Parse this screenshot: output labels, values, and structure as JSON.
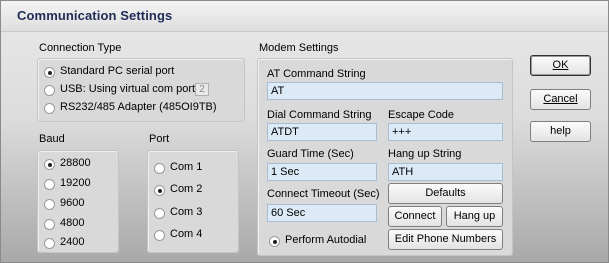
{
  "window": {
    "title": "Communication Settings"
  },
  "connection_type": {
    "label": "Connection Type",
    "options": [
      {
        "label": "Standard PC serial port",
        "selected": true
      },
      {
        "label": "USB: Using virtual com port #",
        "selected": false
      },
      {
        "label": "RS232/485 Adapter (485OI9TB)",
        "selected": false
      }
    ],
    "usb_port_value": "2"
  },
  "baud": {
    "label": "Baud",
    "options": [
      {
        "label": "28800",
        "selected": true
      },
      {
        "label": "19200",
        "selected": false
      },
      {
        "label": "9600",
        "selected": false
      },
      {
        "label": "4800",
        "selected": false
      },
      {
        "label": "2400",
        "selected": false
      }
    ]
  },
  "port": {
    "label": "Port",
    "options": [
      {
        "label": "Com 1",
        "selected": false
      },
      {
        "label": "Com 2",
        "selected": true
      },
      {
        "label": "Com 3",
        "selected": false
      },
      {
        "label": "Com 4",
        "selected": false
      }
    ]
  },
  "modem": {
    "label": "Modem Settings",
    "at_command_label": "AT Command String",
    "at_command_value": "AT",
    "dial_command_label": "Dial Command String",
    "dial_command_value": "ATDT",
    "escape_code_label": "Escape Code",
    "escape_code_value": "+++",
    "guard_time_label": "Guard Time (Sec)",
    "guard_time_value": "1 Sec",
    "hangup_string_label": "Hang up String",
    "hangup_string_value": "ATH",
    "connect_timeout_label": "Connect Timeout (Sec)",
    "connect_timeout_value": "60 Sec",
    "autodial_label": "Perform Autodial",
    "autodial_selected": true,
    "defaults_label": "Defaults",
    "connect_label": "Connect",
    "hangup_label": "Hang up",
    "edit_phone_label": "Edit Phone Numbers"
  },
  "buttons": {
    "ok_label": "OK",
    "cancel_label": "Cancel",
    "help_label": "help"
  }
}
